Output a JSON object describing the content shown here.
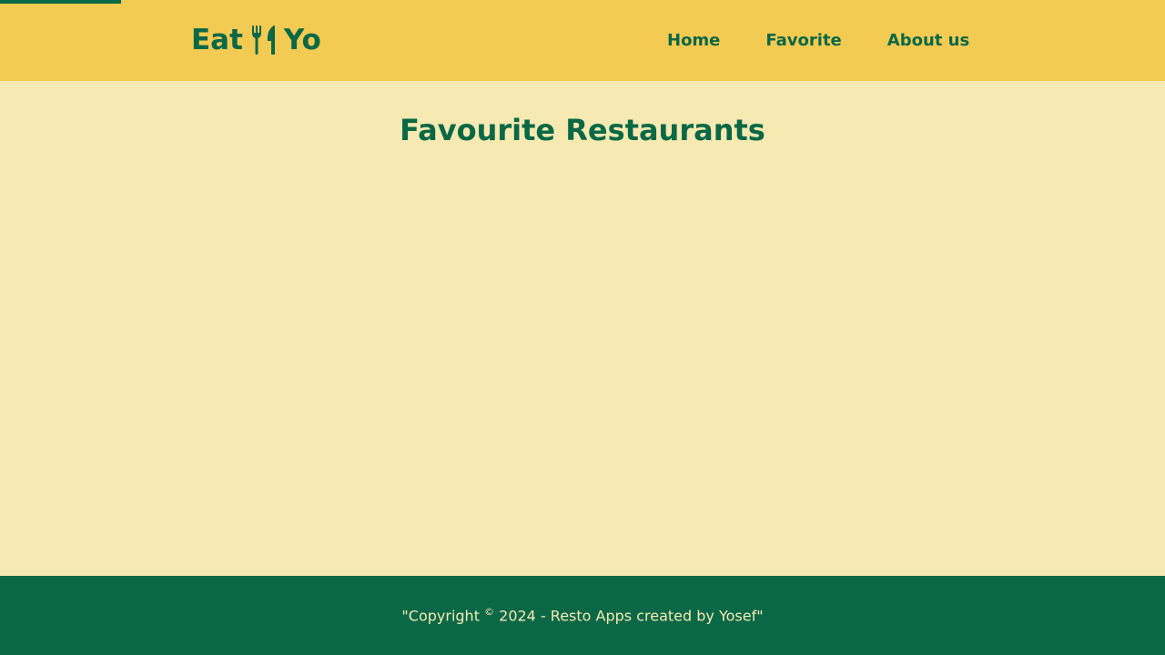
{
  "header": {
    "logo": {
      "text_left": "Eat",
      "icon": "fork-knife-icon",
      "text_right": "Yo"
    },
    "nav": [
      {
        "label": "Home"
      },
      {
        "label": "Favorite"
      },
      {
        "label": "About us"
      }
    ]
  },
  "main": {
    "title": "Favourite Restaurants",
    "restaurants": []
  },
  "footer": {
    "text_before": "\"Copyright ",
    "symbol": "©",
    "text_after": " 2024 - Resto Apps created by Yosef\""
  },
  "colors": {
    "header_bg": "#f3ca52",
    "body_bg": "#f6e9b2",
    "primary": "#0a6847"
  },
  "progress": {
    "value": 0.104
  }
}
